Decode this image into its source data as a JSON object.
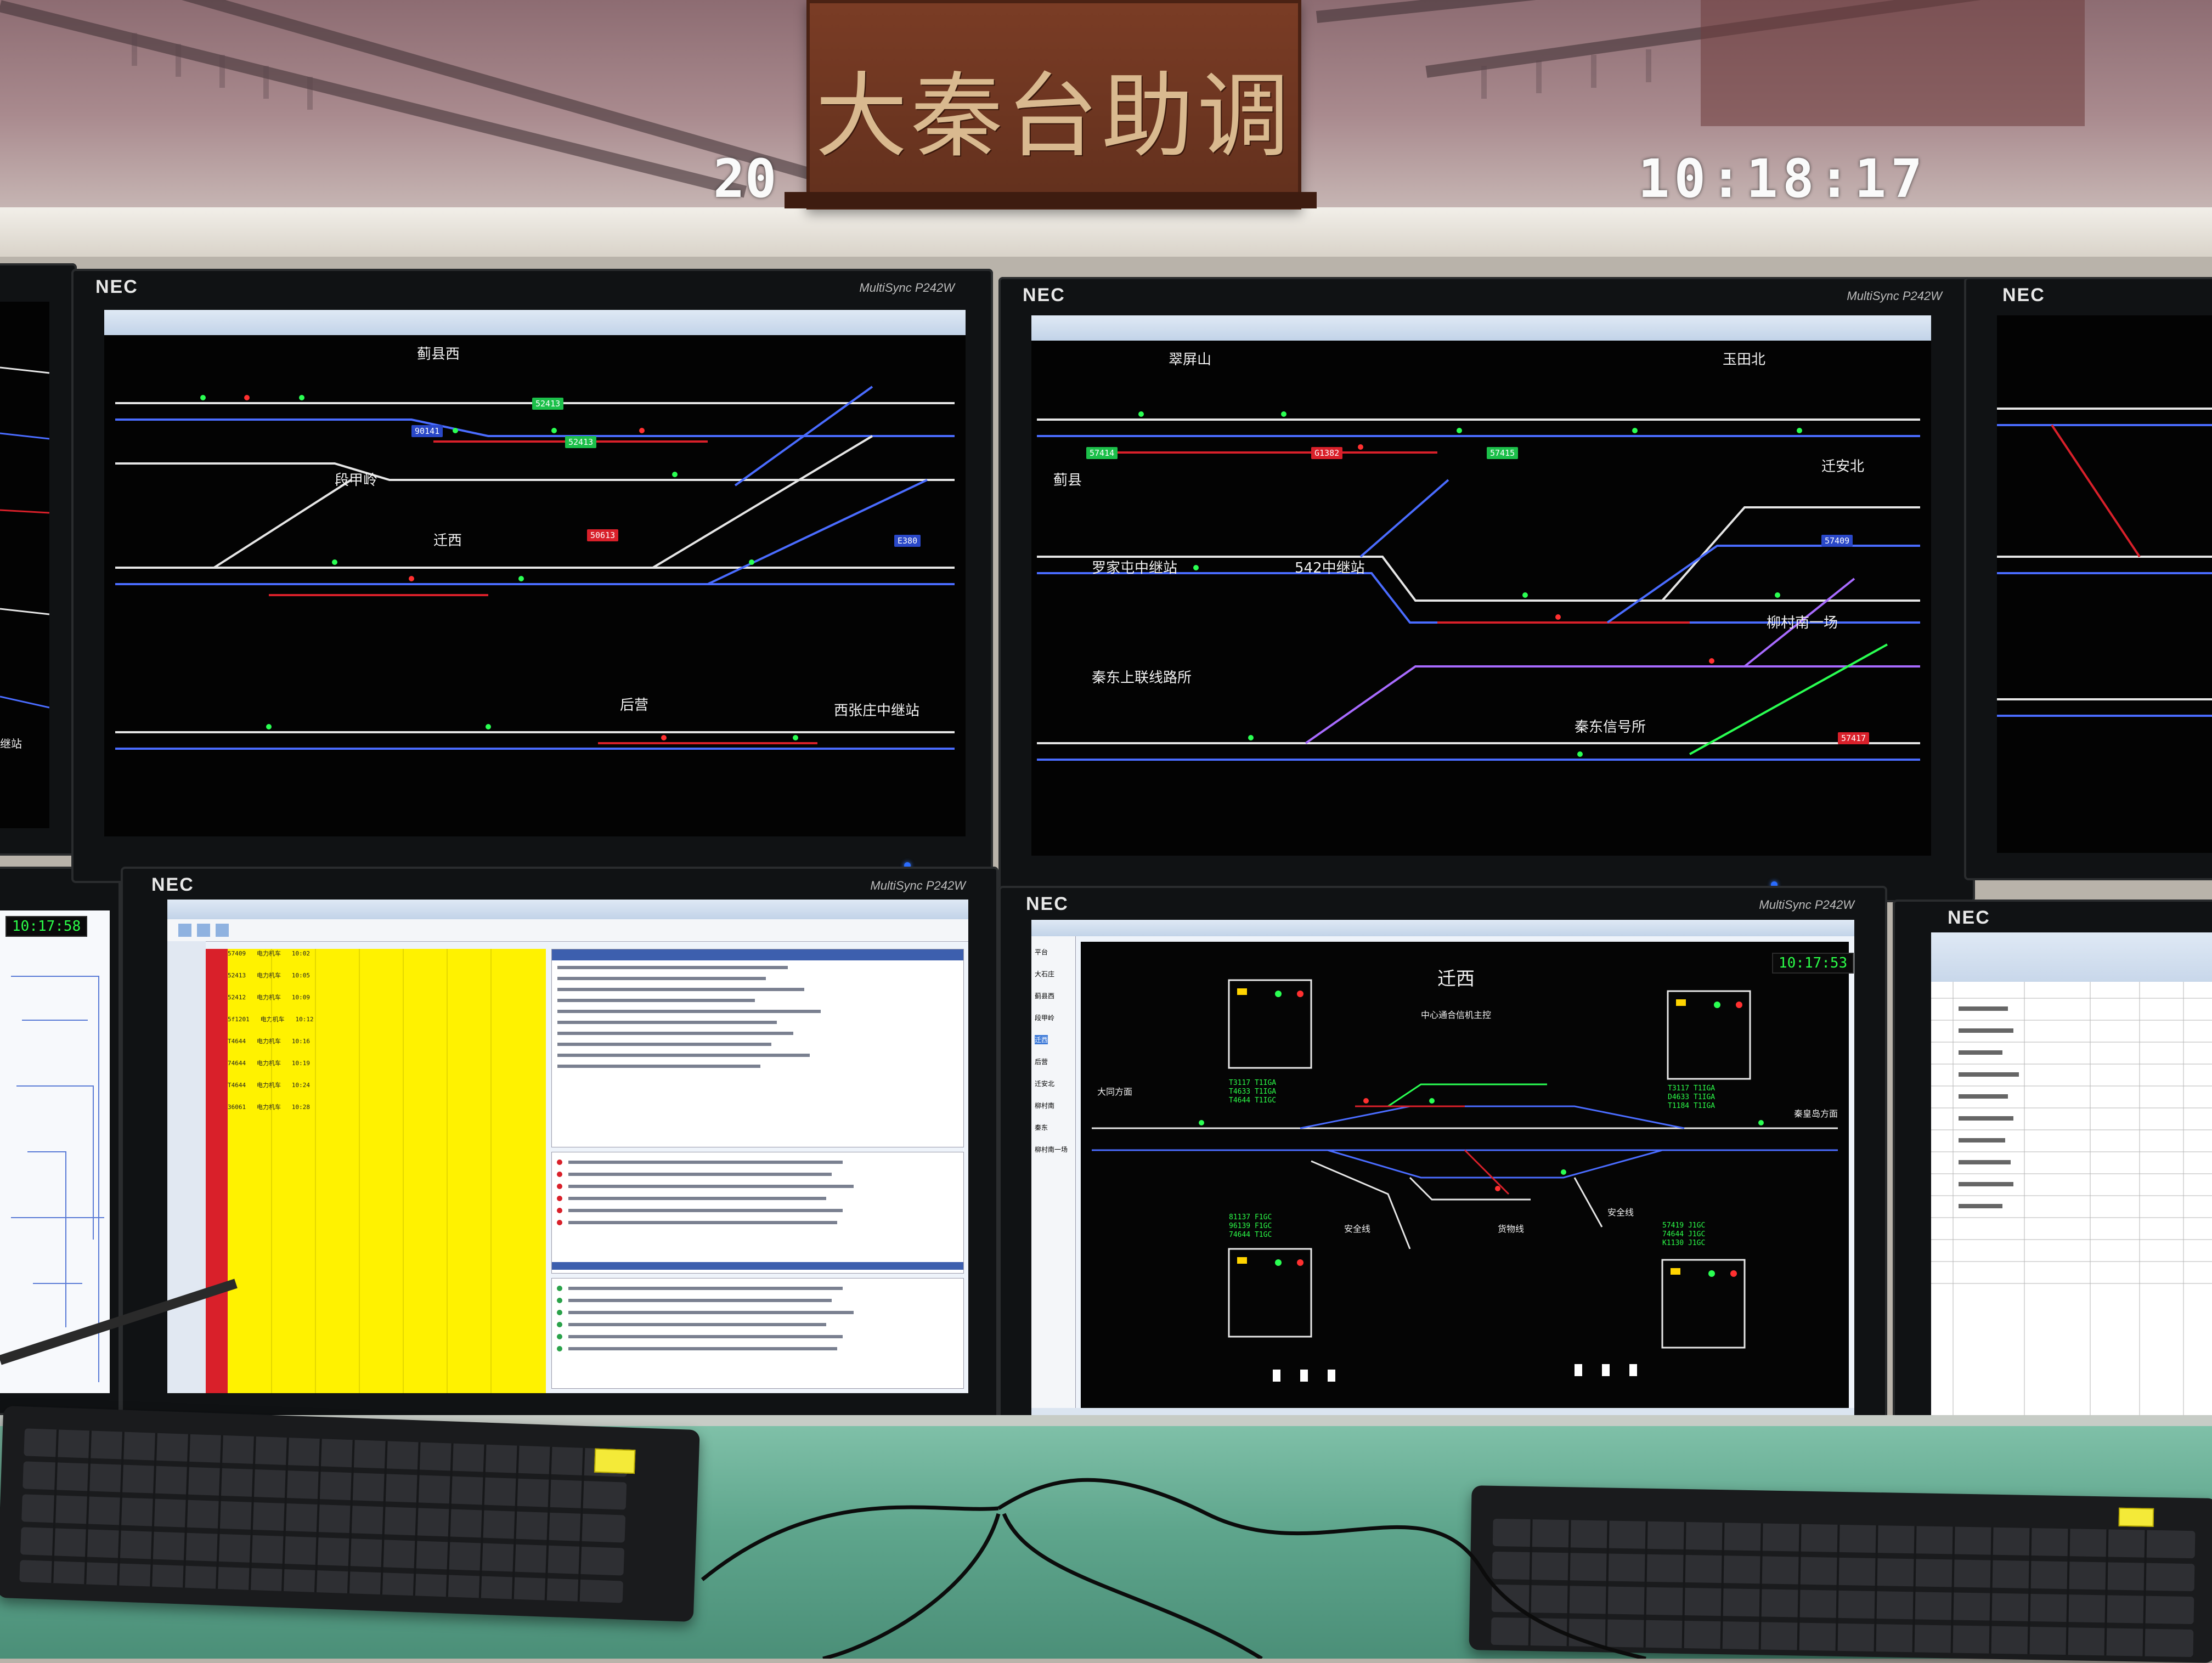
{
  "nameplate": {
    "title": "大秦台助调"
  },
  "wall_video": {
    "clock_left": "20",
    "clock": "10:18:17"
  },
  "monitors": {
    "brand": "NEC",
    "model": "MultiSync P242W"
  },
  "top_left_screen": {
    "stations": [
      "蓟县西",
      "段甲岭",
      "迁西",
      "后营",
      "西张庄中继站"
    ],
    "left_edge_station": "宁北中继站",
    "train_ids": [
      "52413",
      "90141",
      "52413",
      "E380",
      "50613"
    ]
  },
  "top_right_screen": {
    "stations": [
      "翠屏山",
      "玉田北",
      "迁安北",
      "蓟县",
      "罗家屯中继站",
      "542中继站",
      "柳村南一场",
      "秦东上联线路所",
      "秦东信号所"
    ],
    "train_ids": [
      "57414",
      "G1382",
      "57415",
      "57409",
      "57417"
    ]
  },
  "bottom_left_screen": {
    "clock": "10:17:58",
    "rows": [
      [
        "57409",
        "电力机车",
        "10:02"
      ],
      [
        "52413",
        "电力机车",
        "10:05"
      ],
      [
        "52412",
        "电力机车",
        "10:09"
      ],
      [
        "5f1201",
        "电力机车",
        "10:12"
      ],
      [
        "T4644",
        "电力机车",
        "10:16"
      ],
      [
        "74644",
        "电力机车",
        "10:19"
      ],
      [
        "T4644",
        "电力机车",
        "10:24"
      ],
      [
        "36061",
        "电力机车",
        "10:28"
      ]
    ]
  },
  "bottom_right_screen": {
    "station": "迁西",
    "clock": "10:17:53",
    "left_direction": "大同方面",
    "right_direction": "秦皇岛方面",
    "track_labels": [
      "安全线",
      "货物线",
      "安全线"
    ],
    "sidebar_items": [
      "平台",
      "大石庄",
      "蓟县西",
      "段甲岭",
      "迁西",
      "后营",
      "迁安北",
      "柳村南",
      "秦东",
      "柳村南一场"
    ],
    "left_box_trains": [
      "T3117 T1IGA",
      "T4633 T1IGA",
      "T4644 T1IGC"
    ],
    "right_box_trains": [
      "T3117 T1IGA",
      "D4633 T1IGA",
      "T1184 T1IGA"
    ],
    "bottom_left_trains": [
      "81137 F1GC",
      "96139 F1GC",
      "74644 T1GC"
    ],
    "bottom_right_trains": [
      "57419 J1GC",
      "74644 J1GC",
      "K1130 J1GC"
    ],
    "notice": "中心通合信机主控"
  },
  "side_left_screen": {
    "clock": "10:17:58"
  },
  "side_right_screen": {
    "app": "Excel"
  },
  "colors": {
    "signal_green": "#1cc04a",
    "signal_red": "#d9202a",
    "track_blue": "#4a6cff",
    "track_white": "#e6e6e6",
    "grid_yellow": "#fff200",
    "desk_green": "#6fb79b"
  }
}
